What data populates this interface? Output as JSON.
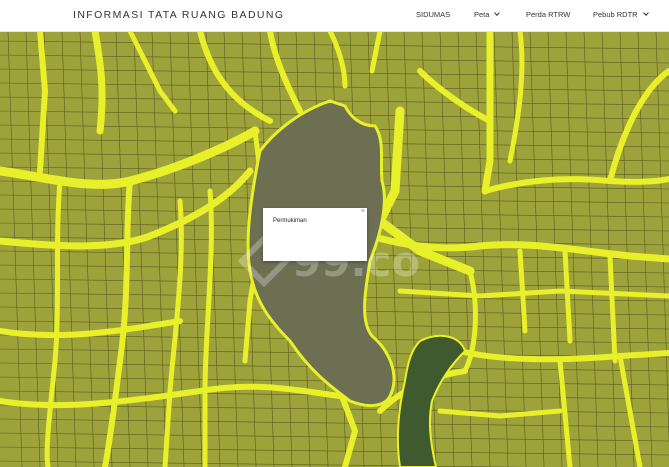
{
  "header": {
    "title": "INFORMASI TATA RUANG BADUNG",
    "nav": [
      {
        "label": "SIDUMAS",
        "dropdown": false
      },
      {
        "label": "Peta",
        "dropdown": true
      },
      {
        "label": "Perda RTRW",
        "dropdown": false
      },
      {
        "label": "Pebub RDTR",
        "dropdown": true
      }
    ]
  },
  "map": {
    "popup": {
      "text": "Permukiman",
      "close": "×"
    },
    "watermark": "99.co",
    "colors": {
      "zone_fill": "#9da23a",
      "roads": "#e8f02a",
      "parcel_lines": "#5c5c20",
      "water_area": "#6d6f52",
      "vegetation": "#3f5a2f"
    }
  }
}
